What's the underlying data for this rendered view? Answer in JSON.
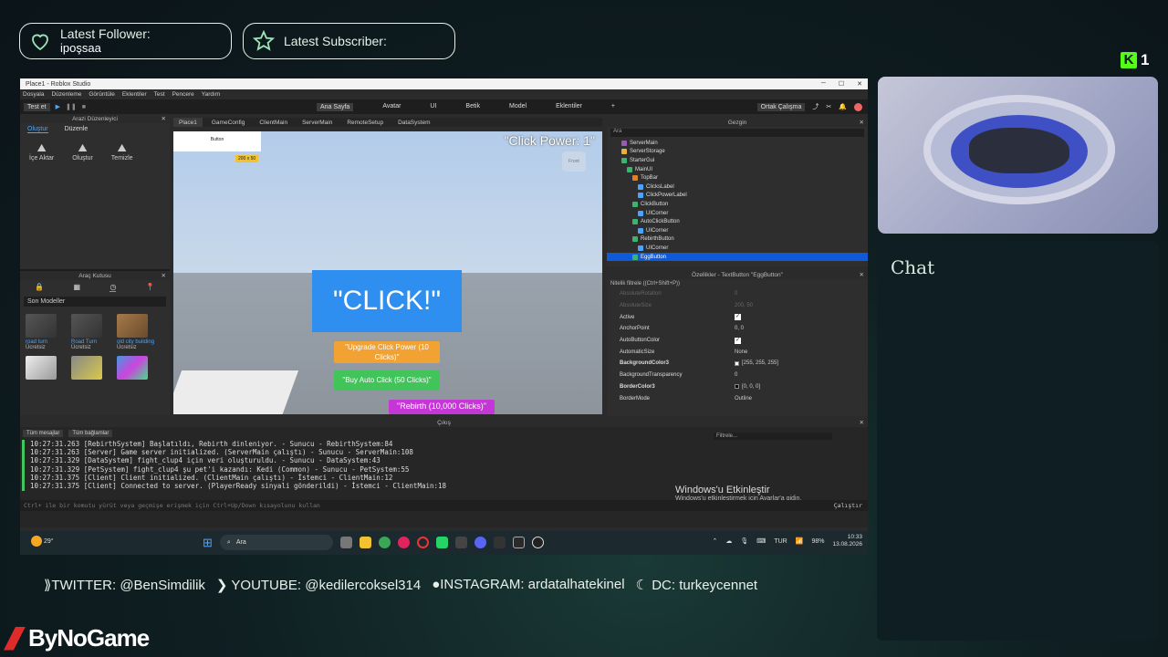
{
  "overlay": {
    "follower_title": "Latest Follower:",
    "follower_name": "ipoşsaa",
    "subscriber_title": "Latest Subscriber:",
    "subscriber_name": "",
    "kick_count": "1",
    "kick_letter": "K"
  },
  "studio": {
    "title": "Place1 - Roblox Studio",
    "menu": [
      "Dosyala",
      "Düzenleme",
      "Görüntüle",
      "Eklentiler",
      "Test",
      "Pencere",
      "Yardım"
    ],
    "test_label": "Test et",
    "ribbon_tabs": [
      "Ana Sayfa",
      "Avatar",
      "UI",
      "Betik",
      "Model",
      "Eklentiler",
      "+"
    ],
    "collab_label": "Ortak Çalışma",
    "terrain": {
      "title": "Arazi Düzenleyici",
      "tabs": [
        "Oluştur",
        "Düzenle"
      ],
      "tools": [
        {
          "label": "İçe Aktar",
          "icon": "import-icon"
        },
        {
          "label": "Oluştur",
          "icon": "generate-icon"
        },
        {
          "label": "Temizle",
          "icon": "clear-icon"
        }
      ]
    },
    "toolbox": {
      "title": "Araç Kutusu",
      "select": "Son Modeller",
      "models": [
        {
          "name": "road turn",
          "tag": "Ücretsiz"
        },
        {
          "name": "Road Turn",
          "tag": "Ücretsiz"
        },
        {
          "name": "old city building",
          "tag": "Ücretsiz"
        },
        {
          "name": "",
          "tag": ""
        },
        {
          "name": "",
          "tag": ""
        },
        {
          "name": "",
          "tag": ""
        }
      ]
    },
    "doc_tabs": [
      "Place1",
      "GameConfig",
      "ClientMain",
      "ServerMain",
      "RemoteSetup",
      "DataSystem"
    ],
    "viewport": {
      "button_label": "Button",
      "size_label": "200 x 50",
      "click_power": "\"Click Power: 1\"",
      "big_button": "\"CLICK!\"",
      "upgrade": "\"Upgrade Click Power (10 Clicks)\"",
      "auto": "\"Buy Auto Click (50 Clicks)\"",
      "rebirth": "\"Rebirth (10,000 Clicks)\"",
      "front_label": "Front"
    },
    "explorer": {
      "title": "Gezgin",
      "search": "Ara",
      "items": [
        {
          "label": "ServerMain",
          "depth": 0,
          "color": "#9b59b6"
        },
        {
          "label": "ServerStorage",
          "depth": 0,
          "color": "#e6b23c"
        },
        {
          "label": "StarterGui",
          "depth": 0,
          "color": "#3cb371"
        },
        {
          "label": "MainUI",
          "depth": 1,
          "color": "#3cb371"
        },
        {
          "label": "TopBar",
          "depth": 2,
          "color": "#e67e22"
        },
        {
          "label": "ClicksLabel",
          "depth": 3,
          "color": "#4aa3ff"
        },
        {
          "label": "ClickPowerLabel",
          "depth": 3,
          "color": "#4aa3ff"
        },
        {
          "label": "ClickButton",
          "depth": 2,
          "color": "#3cb371"
        },
        {
          "label": "UICorner",
          "depth": 3,
          "color": "#4aa3ff"
        },
        {
          "label": "AutoClickButton",
          "depth": 2,
          "color": "#3cb371"
        },
        {
          "label": "UICorner",
          "depth": 3,
          "color": "#4aa3ff"
        },
        {
          "label": "RebirthButton",
          "depth": 2,
          "color": "#3cb371"
        },
        {
          "label": "UICorner",
          "depth": 3,
          "color": "#4aa3ff"
        },
        {
          "label": "EggButton",
          "depth": 2,
          "color": "#3cb371",
          "selected": true
        }
      ]
    },
    "properties": {
      "title": "Özellikler - TextButton \"EggButton\"",
      "filter": "Nitelik filtrele ((Ctrl+Shift+P))",
      "rows": [
        {
          "key": "AbsoluteRotation",
          "value": "0",
          "dim": true
        },
        {
          "key": "AbsoluteSize",
          "value": "200, 50",
          "dim": true
        },
        {
          "key": "Active",
          "value": "",
          "check": true
        },
        {
          "key": "AnchorPoint",
          "value": "0, 0"
        },
        {
          "key": "AutoButtonColor",
          "value": "",
          "check": true
        },
        {
          "key": "AutomaticSize",
          "value": "None"
        },
        {
          "key": "BackgroundColor3",
          "value": "[255, 255, 255]",
          "bold": true,
          "swatch": "#ffffff"
        },
        {
          "key": "BackgroundTransparency",
          "value": "0"
        },
        {
          "key": "BorderColor3",
          "value": "[0, 0, 0]",
          "bold": true,
          "swatch": "#000000"
        },
        {
          "key": "BorderMode",
          "value": "Outline"
        }
      ]
    },
    "output": {
      "title": "Çıkış",
      "msg_filter": "Tüm mesajlar",
      "ctx_filter": "Tüm bağlamlar",
      "filter_placeholder": "Filtrele...",
      "logs": [
        "10:27:31.263  [RebirthSystem] Başlatıldı, Rebirth dinleniyor.  -  Sunucu - RebirthSystem:84",
        "10:27:31.263  [Server] Game server initialized. (ServerMain çalıştı)  -  Sunucu - ServerMain:108",
        "10:27:31.329  [DataSystem] fight_clup4 için veri oluşturuldu.  -  Sunucu - DataSystem:43",
        "10:27:31.329  [PetSystem] fight_clup4 şu pet'i kazandı: Kedi (Common)  -  Sunucu - PetSystem:55",
        "10:27:31.375  [Client] Client initialized. (ClientMain çalıştı)  -  İstemci - ClientMain:12",
        "10:27:31.375  [Client] Connected to server. (PlayerReady sinyali gönderildi)  -  İstemci - ClientMain:18"
      ],
      "command_placeholder": "Ctrl+ ile bir komutu yürüt veya geçmişe erişmek için Ctrl+Up/Down kısayolunu kullan",
      "run_label": "Çalıştır"
    },
    "activation": {
      "title": "Windows'u Etkinleştir",
      "subtitle": "Windows'u etkinleştirmek için Ayarlar'a gidin."
    }
  },
  "taskbar": {
    "weather": "29°",
    "search": "Ara",
    "language": "TUR",
    "battery": "98%",
    "time": "10:33",
    "date": "13.08.2026"
  },
  "chat": {
    "title": "Chat"
  },
  "socials": {
    "twitter": "TWITTER: @BenSimdilik",
    "youtube": "YOUTUBE: @kedilercoksel314",
    "instagram": "INSTAGRAM: ardatalhatekinel",
    "discord": "DC: turkeycennet"
  },
  "brand": {
    "name": "ByNoGame"
  },
  "colors": {
    "accent": "#4aa3ff",
    "kick": "#53fc18",
    "selection": "#0f5ad8",
    "log_bar": "#3ec85f"
  }
}
